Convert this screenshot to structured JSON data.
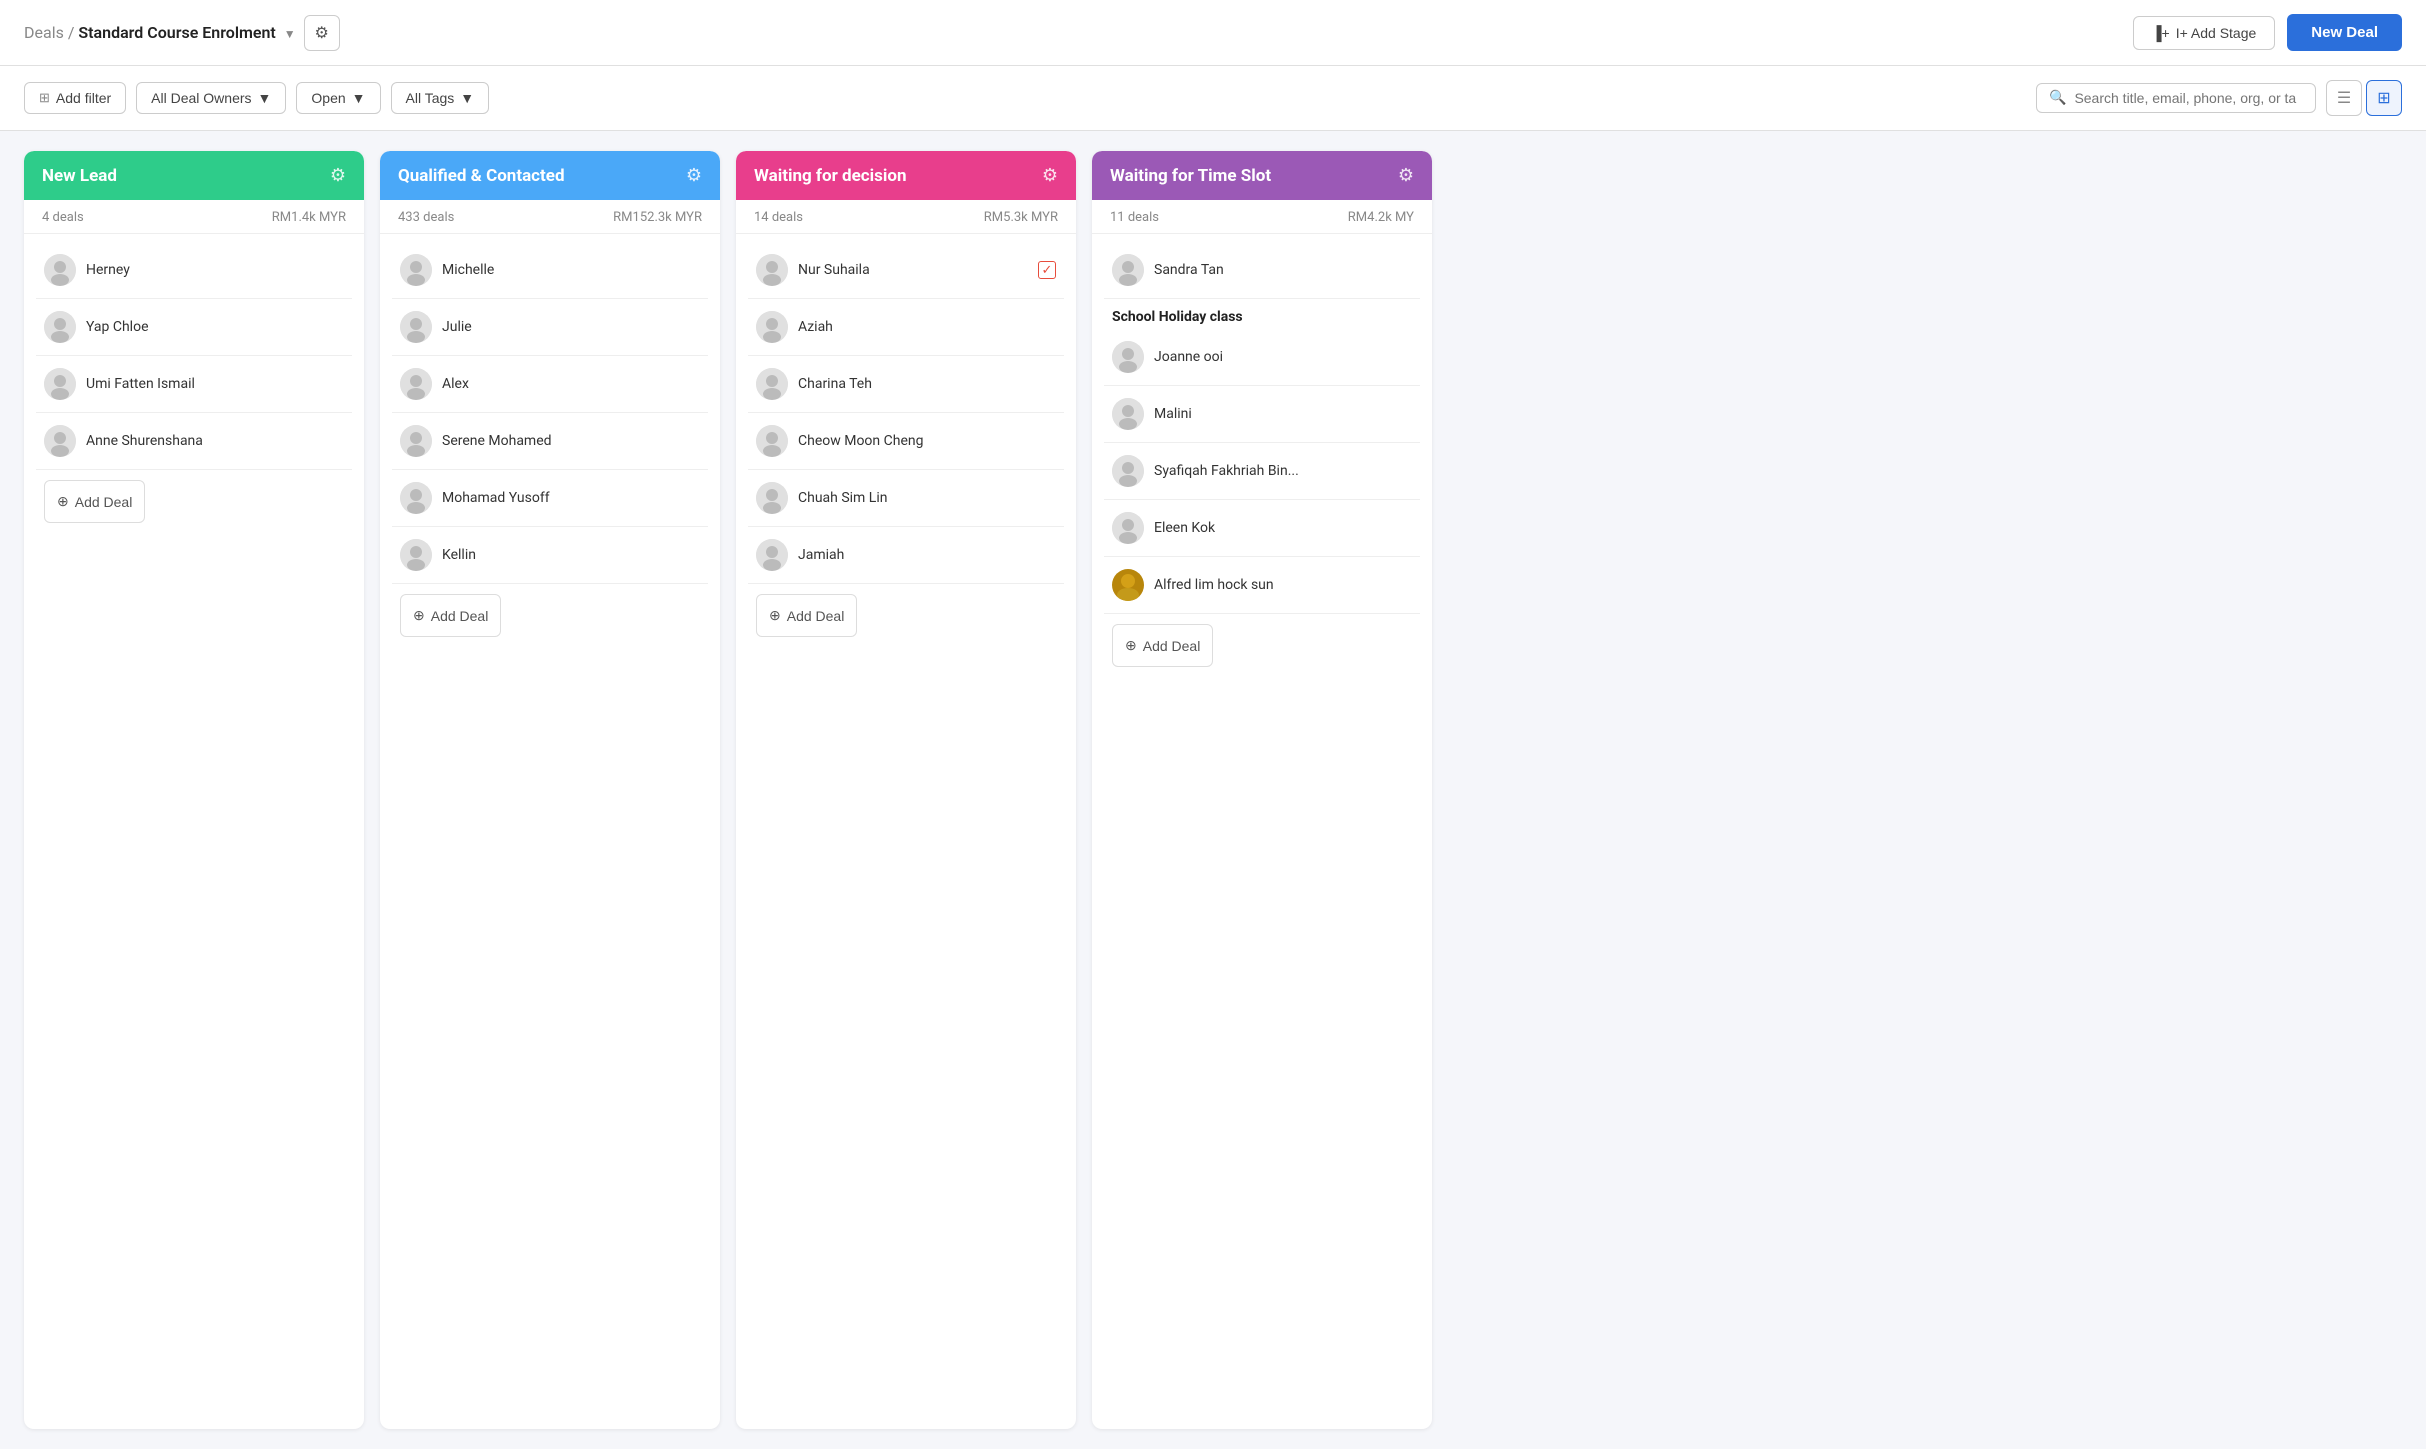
{
  "header": {
    "breadcrumb_prefix": "Deals",
    "breadcrumb_separator": " / ",
    "breadcrumb_title": "Standard Course Enrolment",
    "add_stage_label": "I+ Add Stage",
    "new_deal_label": "New Deal"
  },
  "filter_bar": {
    "add_filter_label": "Add filter",
    "owner_label": "All Deal Owners",
    "status_label": "Open",
    "tags_label": "All Tags",
    "search_placeholder": "Search title, email, phone, org, or ta"
  },
  "columns": [
    {
      "id": "new-lead",
      "title": "New Lead",
      "color_class": "col-green",
      "deals_count": "4 deals",
      "deals_value": "RM1.4k MYR",
      "cards": [
        {
          "name": "Herney",
          "avatar_text": "👤"
        },
        {
          "name": "Yap Chloe",
          "avatar_text": "👤"
        },
        {
          "name": "Umi Fatten Ismail",
          "avatar_text": "👤"
        },
        {
          "name": "Anne Shurenshana",
          "avatar_text": "👤"
        }
      ],
      "add_deal_label": "Add Deal",
      "show_add_deal": true
    },
    {
      "id": "qualified-contacted",
      "title": "Qualified & Contacted",
      "color_class": "col-blue",
      "deals_count": "433 deals",
      "deals_value": "RM152.3k MYR",
      "cards": [
        {
          "name": "Michelle",
          "avatar_text": "👤"
        },
        {
          "name": "Julie",
          "avatar_text": "👤"
        },
        {
          "name": "Alex",
          "avatar_text": "👤"
        },
        {
          "name": "Serene Mohamed",
          "avatar_text": "👤"
        },
        {
          "name": "Mohamad Yusoff",
          "avatar_text": "👤"
        },
        {
          "name": "Kellin",
          "avatar_text": "👤"
        }
      ],
      "add_deal_label": "Add Deal",
      "show_add_deal": true
    },
    {
      "id": "waiting-decision",
      "title": "Waiting for decision",
      "color_class": "col-pink",
      "deals_count": "14 deals",
      "deals_value": "RM5.3k MYR",
      "cards": [
        {
          "name": "Nur Suhaila",
          "avatar_text": "👤",
          "has_checkbox": true
        },
        {
          "name": "Aziah",
          "avatar_text": "👤"
        },
        {
          "name": "Charina Teh",
          "avatar_text": "👤"
        },
        {
          "name": "Cheow Moon Cheng",
          "avatar_text": "👤"
        },
        {
          "name": "Chuah Sim Lin",
          "avatar_text": "👤"
        },
        {
          "name": "Jamiah",
          "avatar_text": "👤"
        }
      ],
      "add_deal_label": "Add Deal",
      "show_add_deal": true
    },
    {
      "id": "waiting-time-slot",
      "title": "Waiting for Time Slot",
      "color_class": "col-purple",
      "deals_count": "11 deals",
      "deals_value": "RM4.2k MY",
      "cards": [
        {
          "name": "Sandra Tan",
          "avatar_text": "👤"
        },
        {
          "group_label": "School Holiday class",
          "name": "Joanne ooi",
          "avatar_text": "👤"
        },
        {
          "name": "Malini",
          "avatar_text": "👤"
        },
        {
          "name": "Syafiqah Fakhriah Bin...",
          "avatar_text": "👤"
        },
        {
          "name": "Eleen Kok",
          "avatar_text": "👤"
        },
        {
          "name": "Alfred lim hock sun",
          "avatar_text": "👤",
          "has_real_avatar": true
        }
      ],
      "add_deal_label": "Add Deal",
      "show_add_deal": true
    }
  ]
}
